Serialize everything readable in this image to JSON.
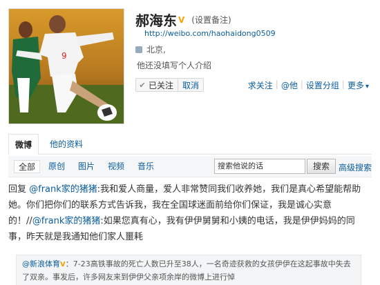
{
  "profile": {
    "name": "郝海东",
    "remark": "(设置备注)",
    "url": "http://weibo.com/haohaidong0509",
    "location": "北京,",
    "bio": "他还没填写个人介绍",
    "verified_icon": "verified-v-icon"
  },
  "follow": {
    "followed_label": "已关注",
    "separator": "|",
    "cancel_label": "取消"
  },
  "actions": {
    "recommend": "求关注",
    "mention": "@他",
    "group": "设置分组",
    "more": "更多"
  },
  "tabs": {
    "weibo": "微博",
    "profile_info": "他的资料"
  },
  "filters": {
    "all": "全部",
    "original": "原创",
    "images": "图片",
    "video": "视频",
    "music": "音乐"
  },
  "search": {
    "placeholder": "搜索他说的话",
    "button": "搜索",
    "advanced": "高级搜索"
  },
  "post": {
    "prefix": "回复 ",
    "mention1": "@frank家的猪猪",
    "text1": ":我和爱人商量，爱人非常赞同我们收养她，我们是真心希望能帮助她。你们把你们的联系方式告诉我，我在全国球迷面前给你们保证，我是诚心实意的！//",
    "mention2": "@frank家的猪猪",
    "text2": ":如果您真有心，我有伊伊舅舅和小姨的电话，我是伊伊妈妈的同事，昨天就是我通知他们家人噩耗"
  },
  "quoted": {
    "author": "@新浪体育",
    "text": "：7-23高铁事故的死亡人数已升至38人，一名奇迹获救的女孩伊伊在这起事故中失去了双亲。事发后，许多网友来到伊伊父亲项余岸的微博上进行悼"
  },
  "colors": {
    "link": "#0a5c9e",
    "verified": "#f2a200",
    "filter_bg": "#f4f6f7"
  }
}
